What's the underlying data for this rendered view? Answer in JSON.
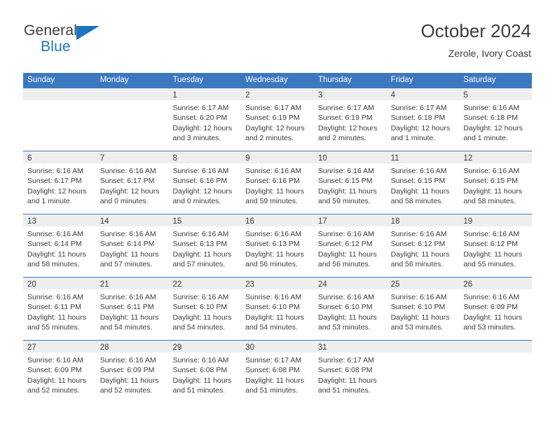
{
  "brand": {
    "name_top": "General",
    "name_bottom": "Blue",
    "triangle_icon": "triangle-icon",
    "accent_color": "#1b75bb"
  },
  "header": {
    "title": "October 2024",
    "subtitle": "Zerole, Ivory Coast"
  },
  "theme": {
    "header_blue": "#3b78bf",
    "daynum_band": "#eeeeee",
    "text": "#3c3c3c"
  },
  "weekdays": [
    "Sunday",
    "Monday",
    "Tuesday",
    "Wednesday",
    "Thursday",
    "Friday",
    "Saturday"
  ],
  "weeks": [
    [
      {
        "day": "",
        "empty": true,
        "sunrise": "",
        "sunset": "",
        "daylight_1": "",
        "daylight_2": ""
      },
      {
        "day": "",
        "empty": true,
        "sunrise": "",
        "sunset": "",
        "daylight_1": "",
        "daylight_2": ""
      },
      {
        "day": "1",
        "empty": false,
        "sunrise": "Sunrise: 6:17 AM",
        "sunset": "Sunset: 6:20 PM",
        "daylight_1": "Daylight: 12 hours",
        "daylight_2": "and 3 minutes."
      },
      {
        "day": "2",
        "empty": false,
        "sunrise": "Sunrise: 6:17 AM",
        "sunset": "Sunset: 6:19 PM",
        "daylight_1": "Daylight: 12 hours",
        "daylight_2": "and 2 minutes."
      },
      {
        "day": "3",
        "empty": false,
        "sunrise": "Sunrise: 6:17 AM",
        "sunset": "Sunset: 6:19 PM",
        "daylight_1": "Daylight: 12 hours",
        "daylight_2": "and 2 minutes."
      },
      {
        "day": "4",
        "empty": false,
        "sunrise": "Sunrise: 6:17 AM",
        "sunset": "Sunset: 6:18 PM",
        "daylight_1": "Daylight: 12 hours",
        "daylight_2": "and 1 minute."
      },
      {
        "day": "5",
        "empty": false,
        "sunrise": "Sunrise: 6:16 AM",
        "sunset": "Sunset: 6:18 PM",
        "daylight_1": "Daylight: 12 hours",
        "daylight_2": "and 1 minute."
      }
    ],
    [
      {
        "day": "6",
        "empty": false,
        "sunrise": "Sunrise: 6:16 AM",
        "sunset": "Sunset: 6:17 PM",
        "daylight_1": "Daylight: 12 hours",
        "daylight_2": "and 1 minute."
      },
      {
        "day": "7",
        "empty": false,
        "sunrise": "Sunrise: 6:16 AM",
        "sunset": "Sunset: 6:17 PM",
        "daylight_1": "Daylight: 12 hours",
        "daylight_2": "and 0 minutes."
      },
      {
        "day": "8",
        "empty": false,
        "sunrise": "Sunrise: 6:16 AM",
        "sunset": "Sunset: 6:16 PM",
        "daylight_1": "Daylight: 12 hours",
        "daylight_2": "and 0 minutes."
      },
      {
        "day": "9",
        "empty": false,
        "sunrise": "Sunrise: 6:16 AM",
        "sunset": "Sunset: 6:16 PM",
        "daylight_1": "Daylight: 11 hours",
        "daylight_2": "and 59 minutes."
      },
      {
        "day": "10",
        "empty": false,
        "sunrise": "Sunrise: 6:16 AM",
        "sunset": "Sunset: 6:15 PM",
        "daylight_1": "Daylight: 11 hours",
        "daylight_2": "and 59 minutes."
      },
      {
        "day": "11",
        "empty": false,
        "sunrise": "Sunrise: 6:16 AM",
        "sunset": "Sunset: 6:15 PM",
        "daylight_1": "Daylight: 11 hours",
        "daylight_2": "and 58 minutes."
      },
      {
        "day": "12",
        "empty": false,
        "sunrise": "Sunrise: 6:16 AM",
        "sunset": "Sunset: 6:15 PM",
        "daylight_1": "Daylight: 11 hours",
        "daylight_2": "and 58 minutes."
      }
    ],
    [
      {
        "day": "13",
        "empty": false,
        "sunrise": "Sunrise: 6:16 AM",
        "sunset": "Sunset: 6:14 PM",
        "daylight_1": "Daylight: 11 hours",
        "daylight_2": "and 58 minutes."
      },
      {
        "day": "14",
        "empty": false,
        "sunrise": "Sunrise: 6:16 AM",
        "sunset": "Sunset: 6:14 PM",
        "daylight_1": "Daylight: 11 hours",
        "daylight_2": "and 57 minutes."
      },
      {
        "day": "15",
        "empty": false,
        "sunrise": "Sunrise: 6:16 AM",
        "sunset": "Sunset: 6:13 PM",
        "daylight_1": "Daylight: 11 hours",
        "daylight_2": "and 57 minutes."
      },
      {
        "day": "16",
        "empty": false,
        "sunrise": "Sunrise: 6:16 AM",
        "sunset": "Sunset: 6:13 PM",
        "daylight_1": "Daylight: 11 hours",
        "daylight_2": "and 56 minutes."
      },
      {
        "day": "17",
        "empty": false,
        "sunrise": "Sunrise: 6:16 AM",
        "sunset": "Sunset: 6:12 PM",
        "daylight_1": "Daylight: 11 hours",
        "daylight_2": "and 56 minutes."
      },
      {
        "day": "18",
        "empty": false,
        "sunrise": "Sunrise: 6:16 AM",
        "sunset": "Sunset: 6:12 PM",
        "daylight_1": "Daylight: 11 hours",
        "daylight_2": "and 56 minutes."
      },
      {
        "day": "19",
        "empty": false,
        "sunrise": "Sunrise: 6:16 AM",
        "sunset": "Sunset: 6:12 PM",
        "daylight_1": "Daylight: 11 hours",
        "daylight_2": "and 55 minutes."
      }
    ],
    [
      {
        "day": "20",
        "empty": false,
        "sunrise": "Sunrise: 6:16 AM",
        "sunset": "Sunset: 6:11 PM",
        "daylight_1": "Daylight: 11 hours",
        "daylight_2": "and 55 minutes."
      },
      {
        "day": "21",
        "empty": false,
        "sunrise": "Sunrise: 6:16 AM",
        "sunset": "Sunset: 6:11 PM",
        "daylight_1": "Daylight: 11 hours",
        "daylight_2": "and 54 minutes."
      },
      {
        "day": "22",
        "empty": false,
        "sunrise": "Sunrise: 6:16 AM",
        "sunset": "Sunset: 6:10 PM",
        "daylight_1": "Daylight: 11 hours",
        "daylight_2": "and 54 minutes."
      },
      {
        "day": "23",
        "empty": false,
        "sunrise": "Sunrise: 6:16 AM",
        "sunset": "Sunset: 6:10 PM",
        "daylight_1": "Daylight: 11 hours",
        "daylight_2": "and 54 minutes."
      },
      {
        "day": "24",
        "empty": false,
        "sunrise": "Sunrise: 6:16 AM",
        "sunset": "Sunset: 6:10 PM",
        "daylight_1": "Daylight: 11 hours",
        "daylight_2": "and 53 minutes."
      },
      {
        "day": "25",
        "empty": false,
        "sunrise": "Sunrise: 6:16 AM",
        "sunset": "Sunset: 6:10 PM",
        "daylight_1": "Daylight: 11 hours",
        "daylight_2": "and 53 minutes."
      },
      {
        "day": "26",
        "empty": false,
        "sunrise": "Sunrise: 6:16 AM",
        "sunset": "Sunset: 6:09 PM",
        "daylight_1": "Daylight: 11 hours",
        "daylight_2": "and 53 minutes."
      }
    ],
    [
      {
        "day": "27",
        "empty": false,
        "sunrise": "Sunrise: 6:16 AM",
        "sunset": "Sunset: 6:09 PM",
        "daylight_1": "Daylight: 11 hours",
        "daylight_2": "and 52 minutes."
      },
      {
        "day": "28",
        "empty": false,
        "sunrise": "Sunrise: 6:16 AM",
        "sunset": "Sunset: 6:09 PM",
        "daylight_1": "Daylight: 11 hours",
        "daylight_2": "and 52 minutes."
      },
      {
        "day": "29",
        "empty": false,
        "sunrise": "Sunrise: 6:16 AM",
        "sunset": "Sunset: 6:08 PM",
        "daylight_1": "Daylight: 11 hours",
        "daylight_2": "and 51 minutes."
      },
      {
        "day": "30",
        "empty": false,
        "sunrise": "Sunrise: 6:17 AM",
        "sunset": "Sunset: 6:08 PM",
        "daylight_1": "Daylight: 11 hours",
        "daylight_2": "and 51 minutes."
      },
      {
        "day": "31",
        "empty": false,
        "sunrise": "Sunrise: 6:17 AM",
        "sunset": "Sunset: 6:08 PM",
        "daylight_1": "Daylight: 11 hours",
        "daylight_2": "and 51 minutes."
      },
      {
        "day": "",
        "empty": true,
        "sunrise": "",
        "sunset": "",
        "daylight_1": "",
        "daylight_2": ""
      },
      {
        "day": "",
        "empty": true,
        "sunrise": "",
        "sunset": "",
        "daylight_1": "",
        "daylight_2": ""
      }
    ]
  ]
}
